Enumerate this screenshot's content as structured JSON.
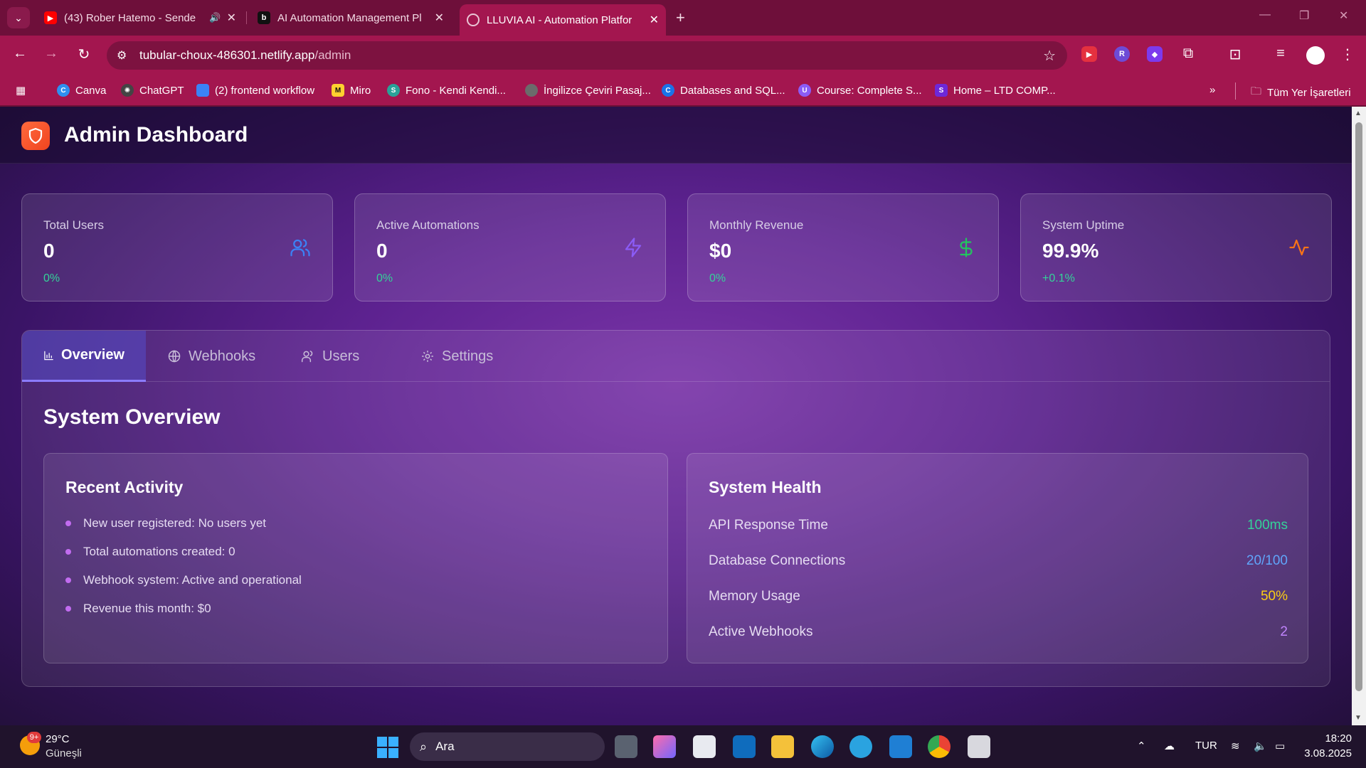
{
  "browser": {
    "tabs": [
      {
        "title": "(43) Rober Hatemo - Sende",
        "favicon": "youtube-icon",
        "color": "#ff0000"
      },
      {
        "title": "AI Automation Management Pl",
        "favicon": "bolt-b-icon",
        "color": "#111111"
      },
      {
        "title": "LLUVIA AI - Automation Platfor",
        "favicon": "globe-icon",
        "color": "#ffffff"
      }
    ],
    "url_host": "tubular-choux-486301.netlify.app",
    "url_path": "/admin",
    "bookmarks": [
      {
        "label": "Canva",
        "color": "#2e8ff0"
      },
      {
        "label": "ChatGPT",
        "color": "#444444"
      },
      {
        "label": "(2) frontend workflow",
        "color": "#3b82f6"
      },
      {
        "label": "Miro",
        "color": "#ffd02f"
      },
      {
        "label": "Fono - Kendi Kendi...",
        "color": "#2aa198"
      },
      {
        "label": "İngilizce Çeviri Pasaj...",
        "color": "#6b6b6b"
      },
      {
        "label": "Databases and SQL...",
        "color": "#1a73e8"
      },
      {
        "label": "Course: Complete S...",
        "color": "#8b5cf6"
      },
      {
        "label": "Home – LTD COMP...",
        "color": "#6d28d9"
      }
    ],
    "bookmarks_folder": "Tüm Yer İşaretleri"
  },
  "app": {
    "title": "Admin Dashboard",
    "stats": [
      {
        "label": "Total Users",
        "value": "0",
        "change": "0%",
        "icon": "users-icon",
        "color": "#3b82f6"
      },
      {
        "label": "Active Automations",
        "value": "0",
        "change": "0%",
        "icon": "zap-icon",
        "color": "#8b5cf6"
      },
      {
        "label": "Monthly Revenue",
        "value": "$0",
        "change": "0%",
        "icon": "dollar-icon",
        "color": "#22c55e"
      },
      {
        "label": "System Uptime",
        "value": "99.9%",
        "change": "+0.1%",
        "icon": "activity-icon",
        "color": "#f97316"
      }
    ],
    "tabs": [
      {
        "label": "Overview",
        "icon": "bar-chart-icon",
        "active": true
      },
      {
        "label": "Webhooks",
        "icon": "globe-icon",
        "active": false
      },
      {
        "label": "Users",
        "icon": "users-icon",
        "active": false
      },
      {
        "label": "Settings",
        "icon": "gear-icon",
        "active": false
      }
    ],
    "section_title": "System Overview",
    "recent_activity": {
      "title": "Recent Activity",
      "items": [
        "New user registered: No users yet",
        "Total automations created: 0",
        "Webhook system: Active and operational",
        "Revenue this month: $0"
      ]
    },
    "system_health": {
      "title": "System Health",
      "rows": [
        {
          "label": "API Response Time",
          "value": "100ms",
          "color": "#34d399"
        },
        {
          "label": "Database Connections",
          "value": "20/100",
          "color": "#60a5fa"
        },
        {
          "label": "Memory Usage",
          "value": "50%",
          "color": "#facc15"
        },
        {
          "label": "Active Webhooks",
          "value": "2",
          "color": "#c084fc"
        }
      ]
    }
  },
  "taskbar": {
    "weather_badge": "9+",
    "temperature": "29°C",
    "condition": "Güneşli",
    "search_placeholder": "Ara",
    "language": "TUR",
    "time": "18:20",
    "date": "3.08.2025"
  }
}
